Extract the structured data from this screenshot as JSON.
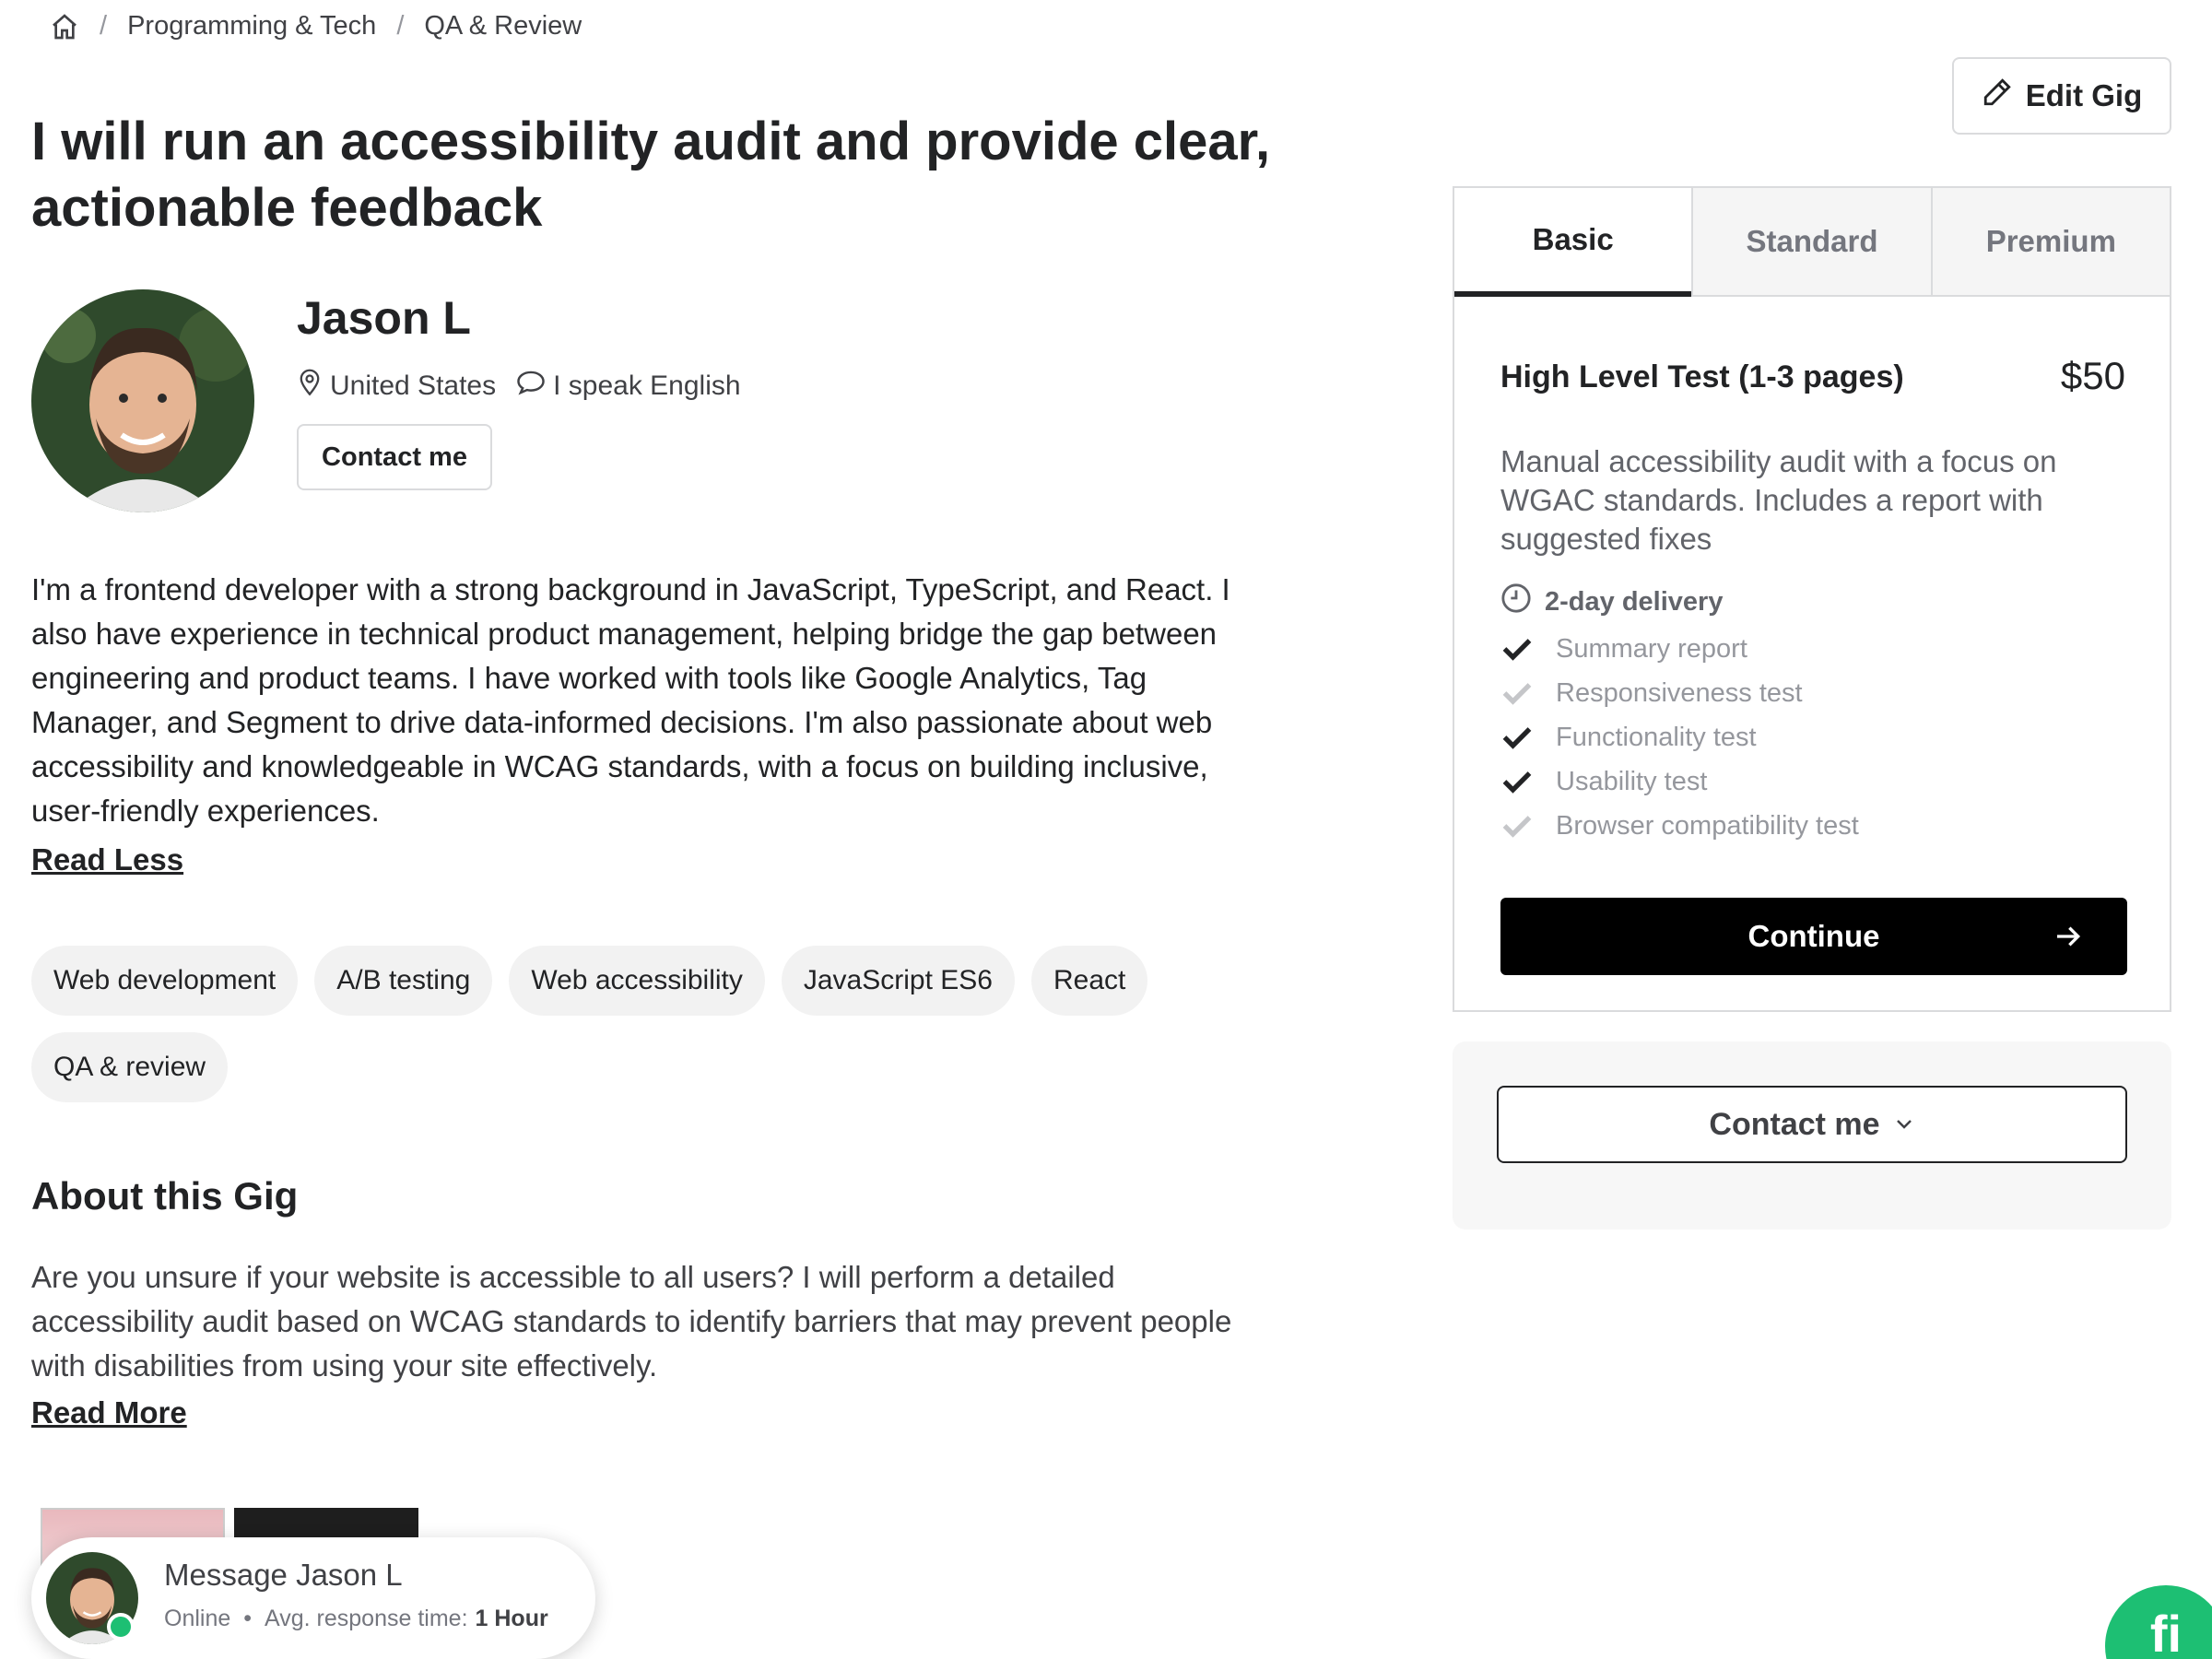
{
  "breadcrumb": {
    "items": [
      "Programming & Tech",
      "QA & Review"
    ],
    "separator": "/"
  },
  "gig": {
    "title": "I will run an accessibility audit and provide clear, actionable feedback"
  },
  "seller": {
    "name": "Jason L",
    "location": "United States",
    "language": "I speak English",
    "contact_label": "Contact me"
  },
  "bio": {
    "text": "I'm a frontend developer with a strong background in JavaScript, TypeScript, and React. I also have experience in technical product management, helping bridge the gap between engineering and product teams. I have worked with tools like Google Analytics, Tag Manager, and Segment to drive data-informed decisions. I'm also passionate about web accessibility and knowledgeable in WCAG standards, with a focus on building inclusive, user-friendly experiences.",
    "toggle_label": "Read Less"
  },
  "tags": [
    "Web development",
    "A/B testing",
    "Web accessibility",
    "JavaScript ES6",
    "React",
    "QA & review"
  ],
  "about": {
    "title": "About this Gig",
    "text": "Are you unsure if your website is accessible to all users? I will perform a detailed accessibility audit based on WCAG standards to identify barriers that may prevent people with disabilities from using your site effectively.",
    "toggle_label": "Read More"
  },
  "message": {
    "title": "Message Jason L",
    "status": "Online",
    "response_label": "Avg. response time:",
    "response_value": "1 Hour"
  },
  "edit_gig_label": "Edit Gig",
  "package": {
    "tabs": [
      "Basic",
      "Standard",
      "Premium"
    ],
    "active_tab": "Basic",
    "name": "High Level Test (1-3 pages)",
    "price": "$50",
    "description": "Manual accessibility audit with a focus on WGAC standards. Includes a report with suggested fixes",
    "delivery": "2-day delivery",
    "features": [
      {
        "label": "Summary report",
        "included": true
      },
      {
        "label": "Responsiveness test",
        "included": false
      },
      {
        "label": "Functionality test",
        "included": true
      },
      {
        "label": "Usability test",
        "included": true
      },
      {
        "label": "Browser compatibility test",
        "included": false
      }
    ],
    "continue_label": "Continue"
  },
  "contact_large_label": "Contact me",
  "badge_text": "fi",
  "colors": {
    "brand_green": "#1dbf73",
    "text_dark": "#222325",
    "check_included": "#222325",
    "check_excluded": "#c5c6c9"
  }
}
